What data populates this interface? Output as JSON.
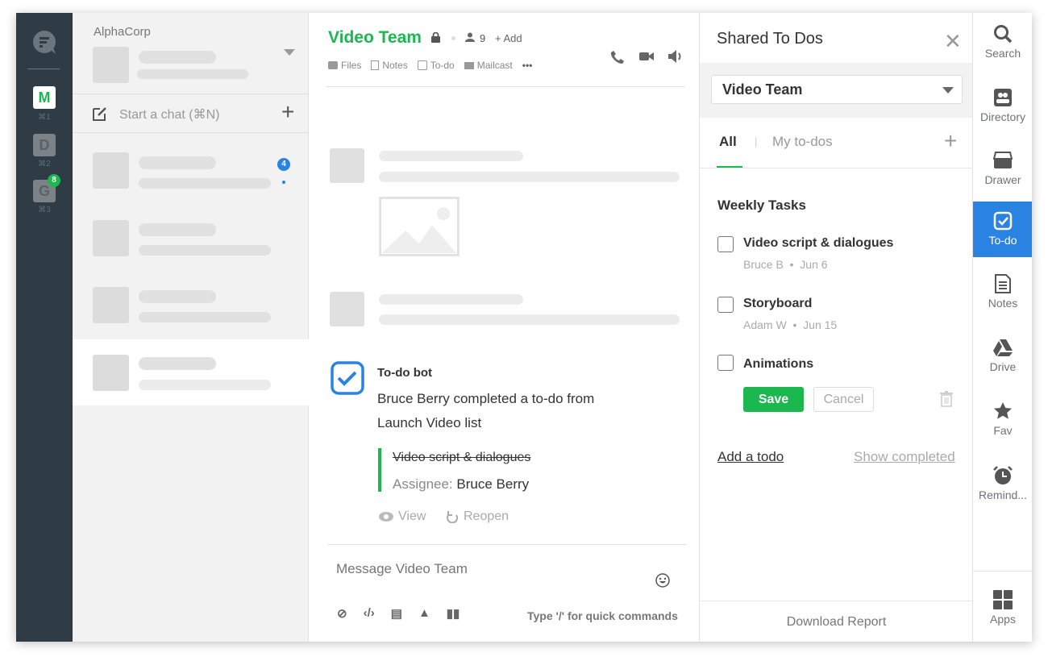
{
  "workspaces": [
    {
      "letter": "M",
      "shortcut": "⌘1"
    },
    {
      "letter": "D",
      "shortcut": "⌘2"
    },
    {
      "letter": "G",
      "shortcut": "⌘3",
      "badge": "8"
    }
  ],
  "sidebar": {
    "org": "AlphaCorp",
    "start_chat": "Start a chat (⌘N)",
    "unread_badge": "4"
  },
  "chat": {
    "title": "Video Team",
    "members": "9",
    "add": "+ Add",
    "tabs": [
      "Files",
      "Notes",
      "To-do",
      "Mailcast"
    ],
    "bot": {
      "name": "To-do bot",
      "line1": "Bruce Berry completed a to-do from",
      "line2": "Launch Video list",
      "task": "Video script & dialogues",
      "assignee_label": "Assignee:",
      "assignee": "Bruce Berry",
      "view": "View",
      "reopen": "Reopen"
    },
    "composer": {
      "placeholder": "Message Video Team",
      "hint": "Type '/' for quick commands"
    }
  },
  "todo": {
    "title": "Shared To Dos",
    "select": "Video Team",
    "tabs": [
      "All",
      "My to-dos"
    ],
    "section": "Weekly Tasks",
    "items": [
      {
        "title": "Video script & dialogues",
        "assignee": "Bruce B",
        "date": "Jun 6"
      },
      {
        "title": "Storyboard",
        "assignee": "Adam W",
        "date": "Jun 15"
      },
      {
        "title": "Animations"
      }
    ],
    "save": "Save",
    "cancel": "Cancel",
    "add": "Add a todo",
    "show_completed": "Show completed",
    "download": "Download Report"
  },
  "right_rail": [
    "Search",
    "Directory",
    "Drawer",
    "To-do",
    "Notes",
    "Drive",
    "Fav",
    "Remind...",
    "Apps"
  ],
  "colors": {
    "brand_green": "#1ab84f",
    "accent_blue": "#2a83e3",
    "rail_dark": "#2f3b45"
  }
}
